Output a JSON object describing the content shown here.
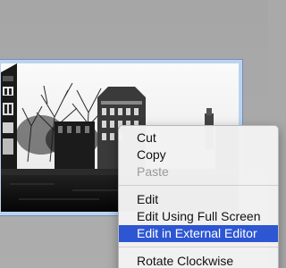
{
  "colors": {
    "background": "#a9a9a9",
    "menu_background": "#f2f2f2",
    "highlight": "#2d56d3",
    "disabled_text": "#9a9a9a",
    "selection_border": "#bcd3ef"
  },
  "photo": {
    "icon": "photo-thumbnail"
  },
  "context_menu": {
    "items": [
      {
        "label": "Cut",
        "state": "enabled"
      },
      {
        "label": "Copy",
        "state": "enabled"
      },
      {
        "label": "Paste",
        "state": "disabled"
      },
      {
        "label": "Edit",
        "state": "enabled"
      },
      {
        "label": "Edit Using Full Screen",
        "state": "enabled"
      },
      {
        "label": "Edit in External Editor",
        "state": "highlighted"
      },
      {
        "label": "Rotate Clockwise",
        "state": "enabled"
      }
    ]
  }
}
